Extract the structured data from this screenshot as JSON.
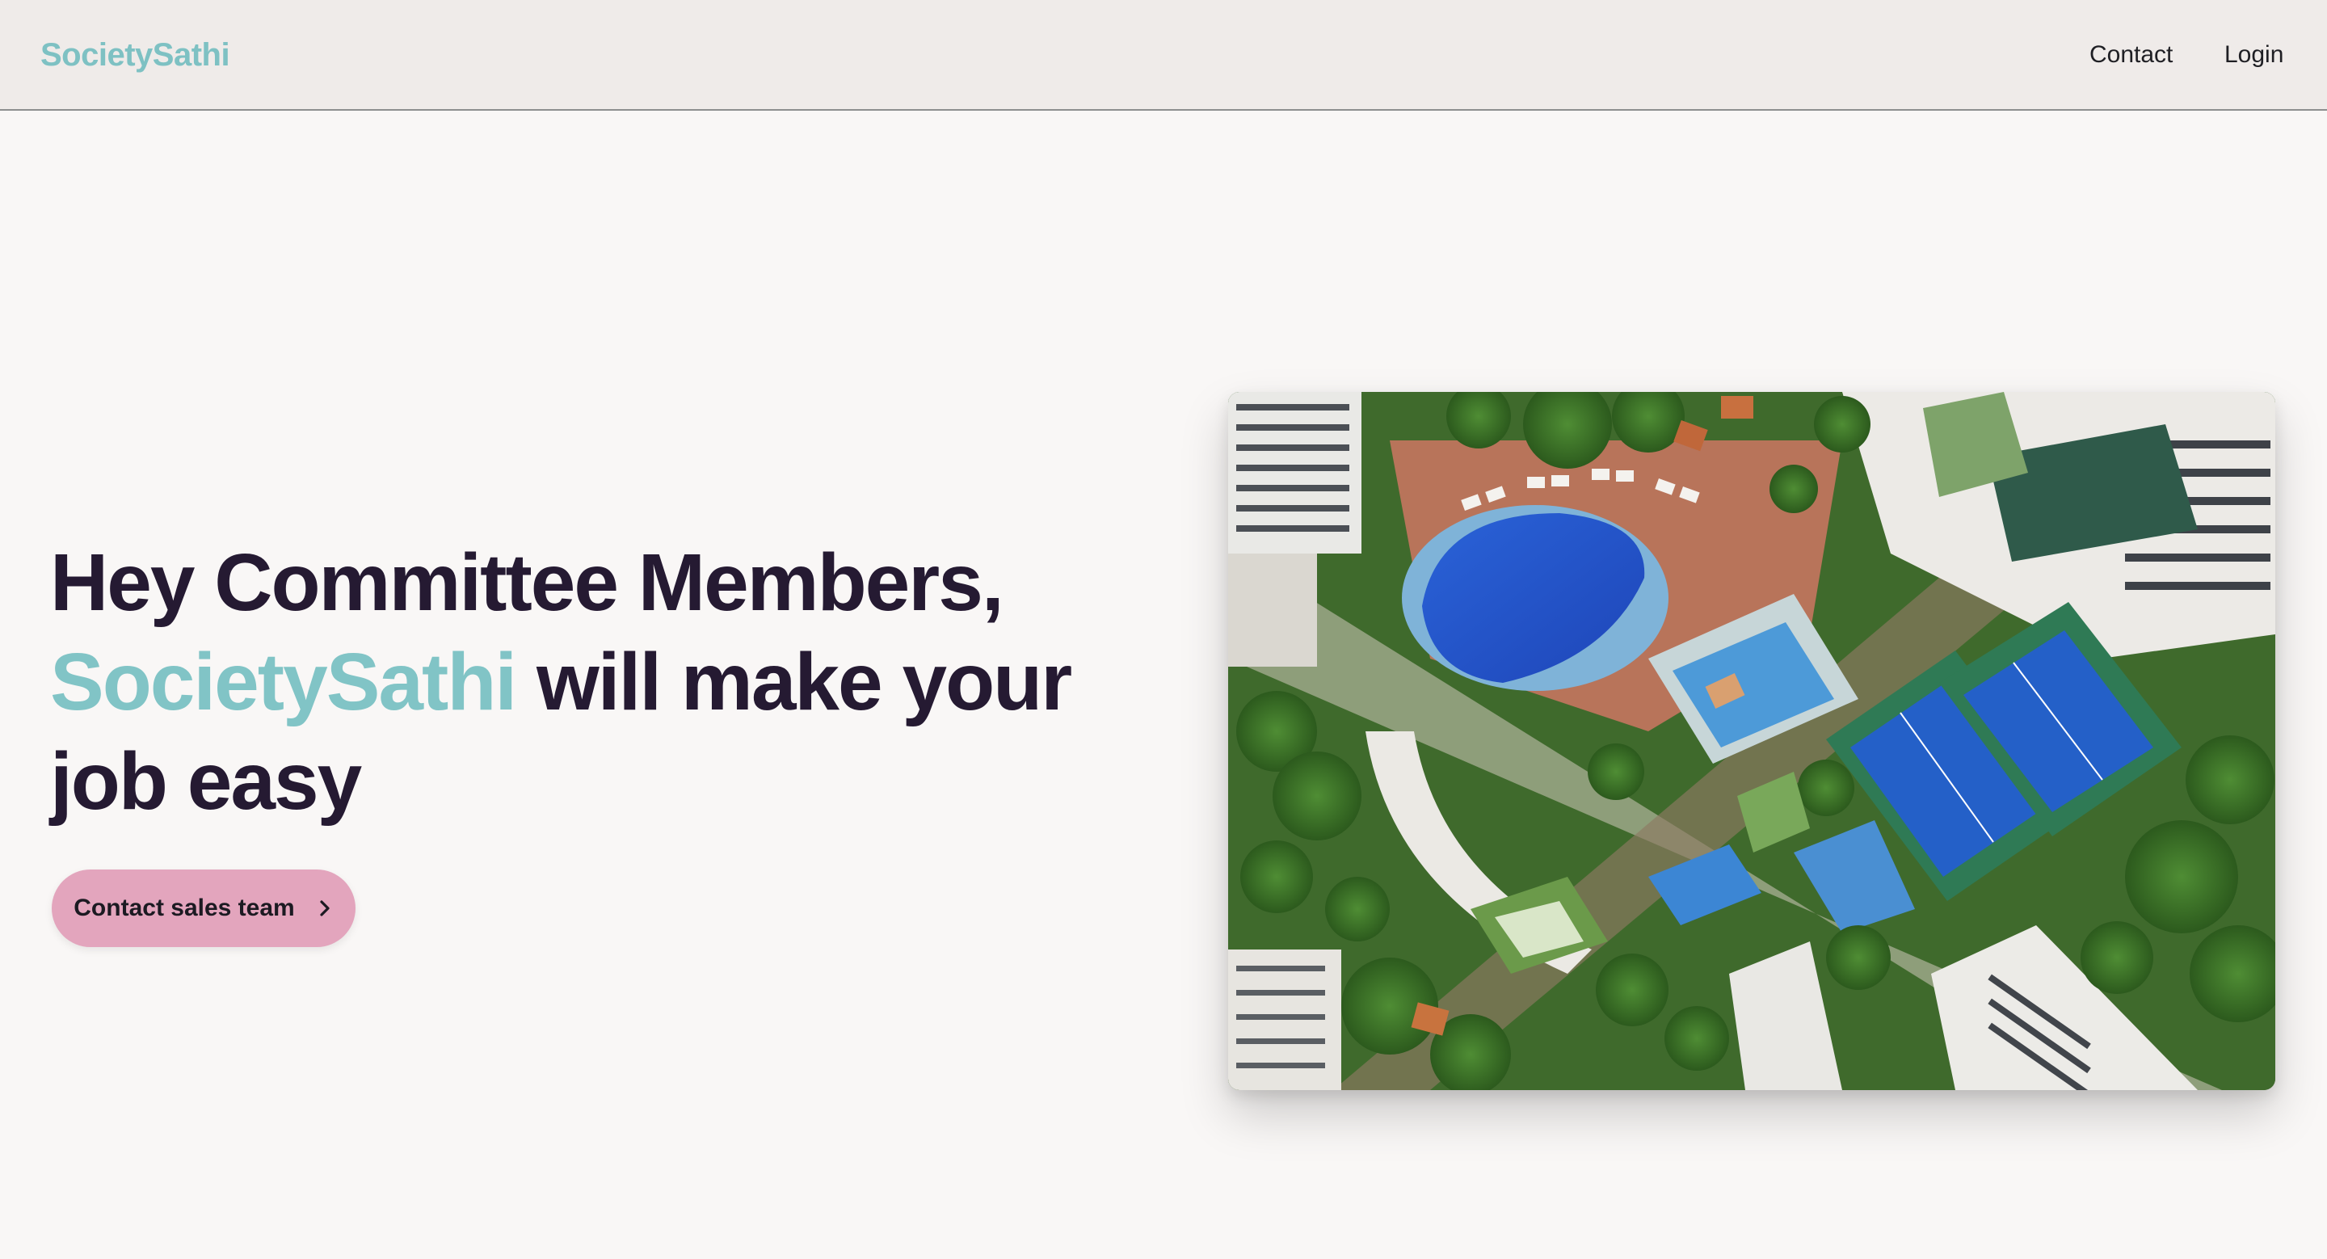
{
  "header": {
    "brand": "SocietySathi",
    "nav": [
      {
        "label": "Contact"
      },
      {
        "label": "Login"
      }
    ]
  },
  "hero": {
    "title_line1": "Hey Committee Members,",
    "title_brand": "SocietySathi",
    "title_rest": " will make your job easy",
    "cta_label": "Contact sales team",
    "cta_icon": "chevron-right-icon"
  },
  "image": {
    "alt": "Aerial view of residential towers with swimming pools, tennis courts and gardens"
  },
  "colors": {
    "brand_accent": "#7ec1c3",
    "cta": "#e3a5bd",
    "heading": "#251a32",
    "nav_bg": "#efebe9",
    "page_bg": "#f9f7f6"
  }
}
